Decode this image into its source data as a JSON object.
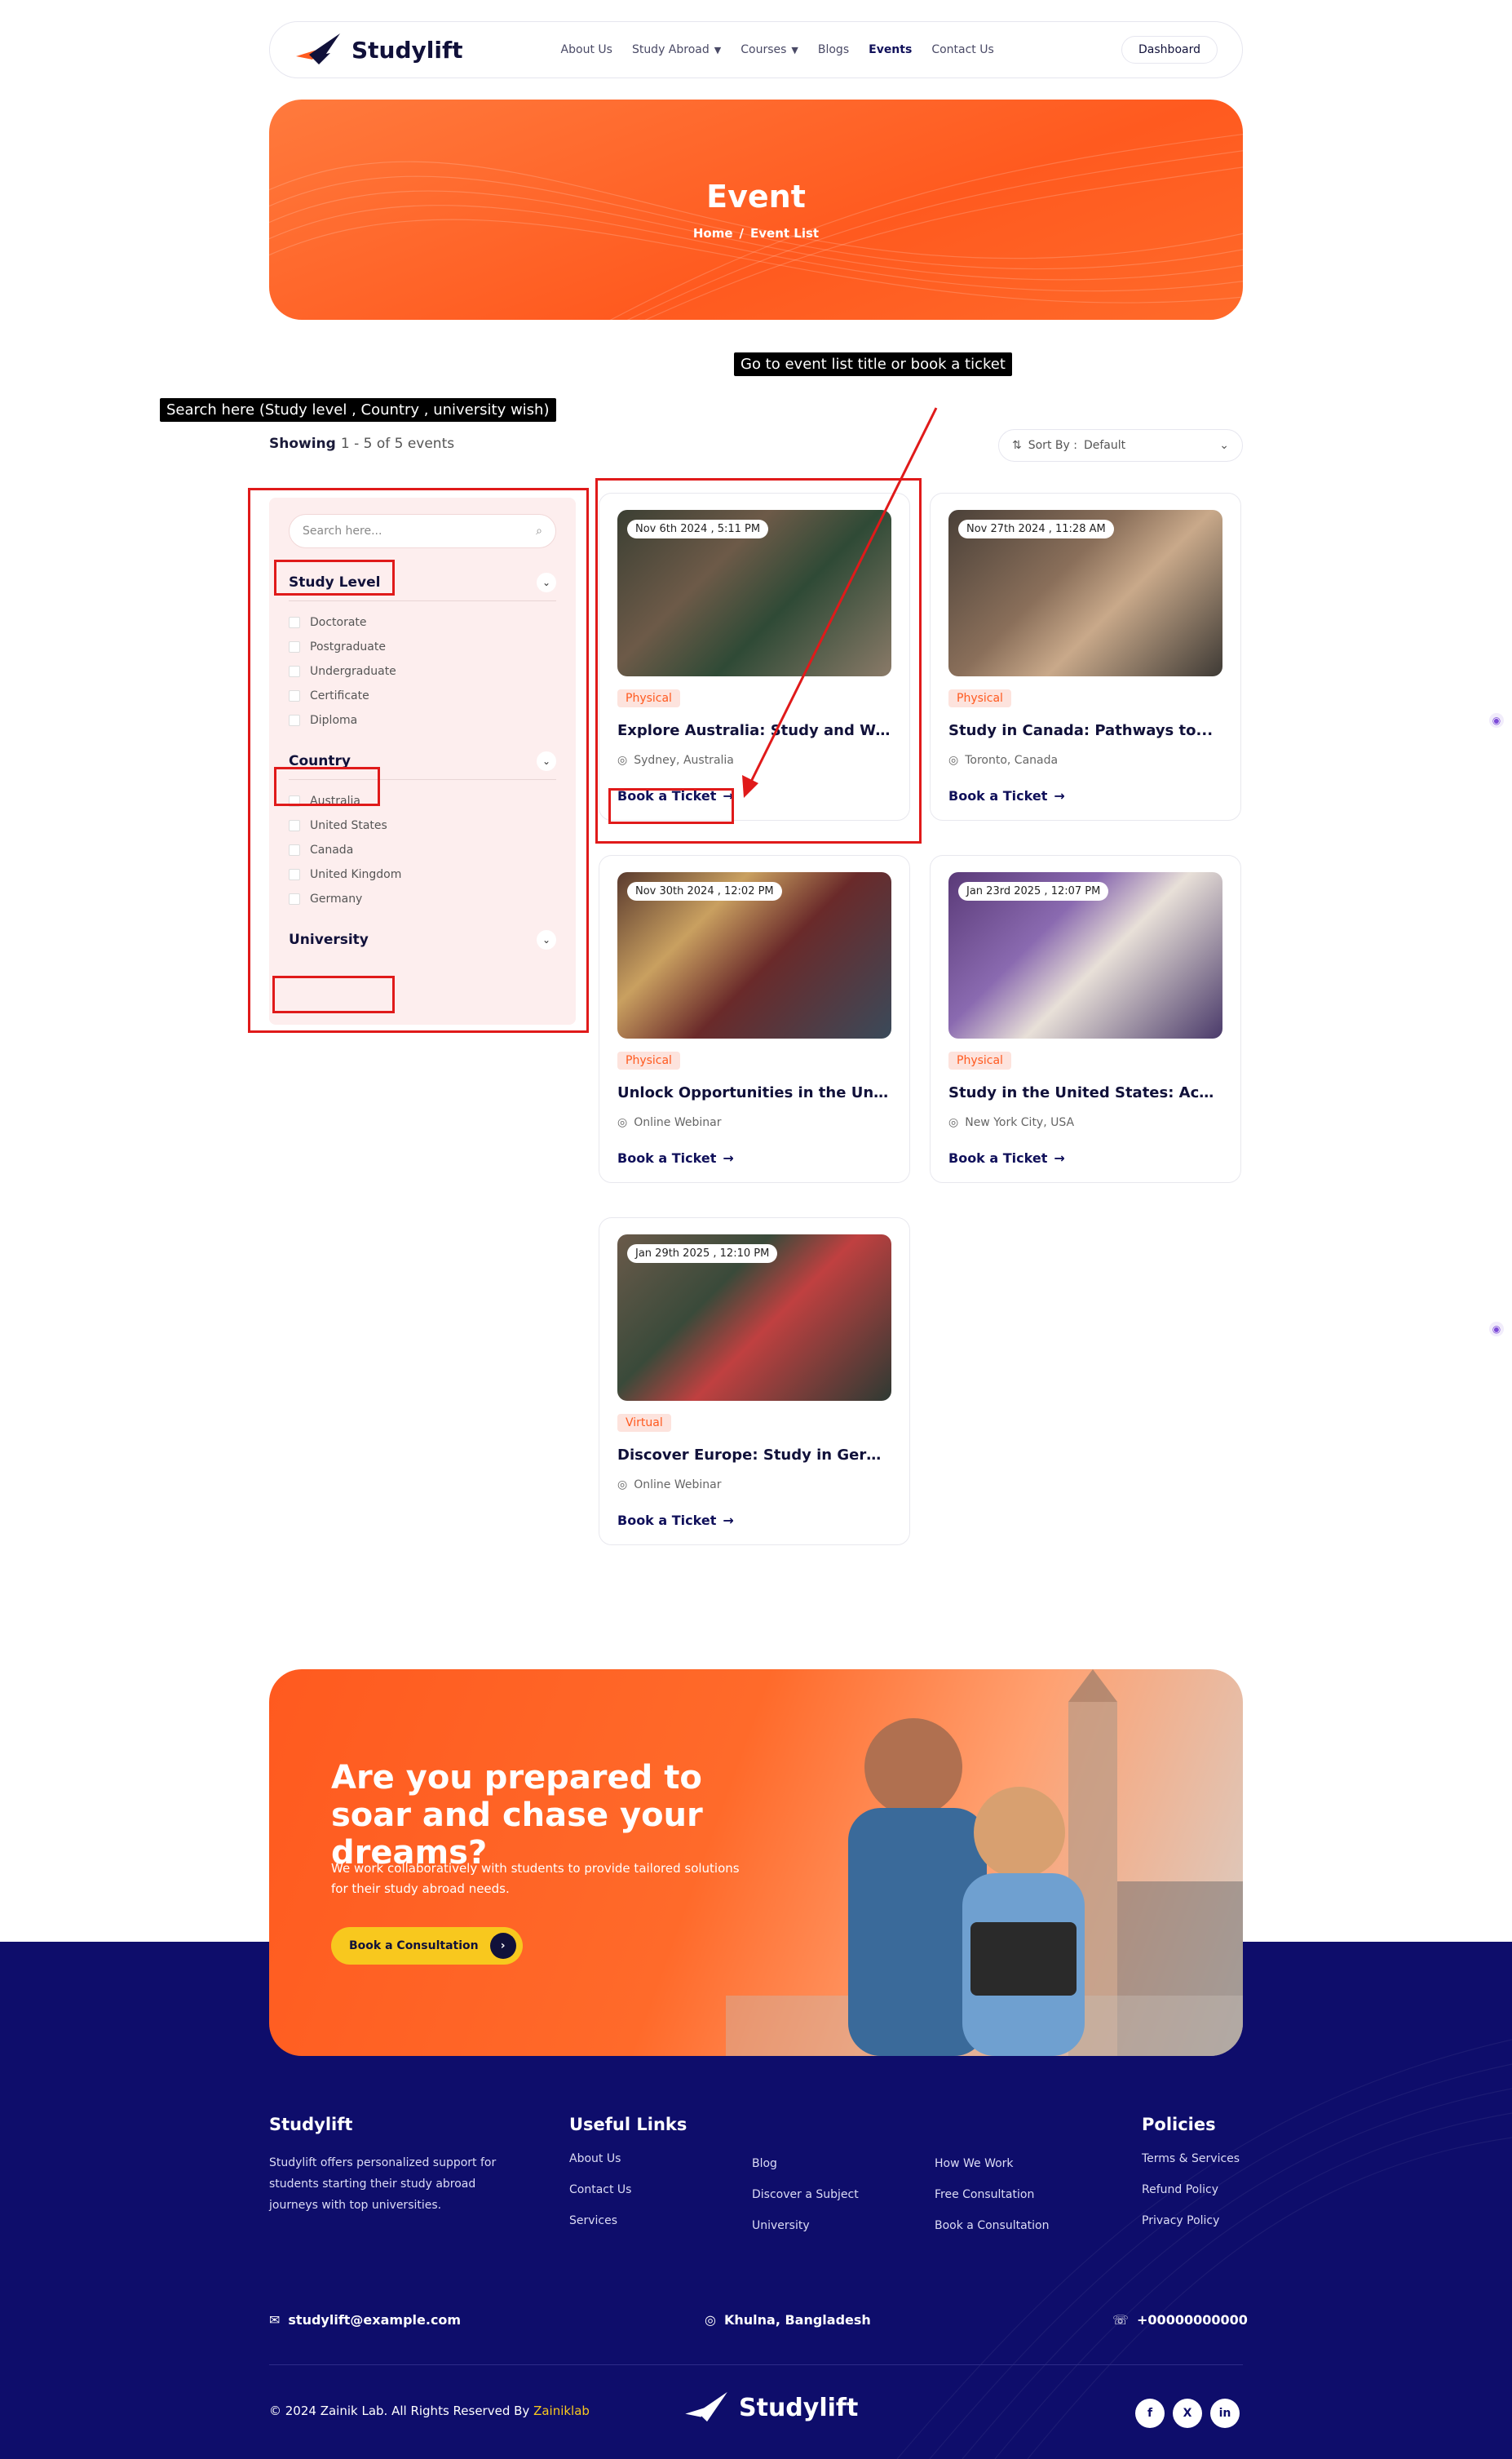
{
  "brand": {
    "name": "Studylift"
  },
  "nav": {
    "items": [
      {
        "label": "About Us"
      },
      {
        "label": "Study Abroad",
        "dropdown": true
      },
      {
        "label": "Courses",
        "dropdown": true
      },
      {
        "label": "Blogs"
      },
      {
        "label": "Events",
        "active": true
      },
      {
        "label": "Contact Us"
      }
    ],
    "dashboard_label": "Dashboard"
  },
  "hero": {
    "title": "Event",
    "breadcrumb_home": "Home",
    "breadcrumb_sep": "/",
    "breadcrumb_current": "Event List"
  },
  "annotations": {
    "tip_event": "Go to event list title or book a ticket",
    "tip_search": "Search here (Study level , Country , university wish)"
  },
  "results": {
    "label": "Showing",
    "count": "1 - 5 of 5 events"
  },
  "sort": {
    "label": "Sort By :",
    "value": "Default"
  },
  "sidebar": {
    "search_placeholder": "Search here...",
    "filters": [
      {
        "title": "Study Level",
        "options": [
          "Doctorate",
          "Postgraduate",
          "Undergraduate",
          "Certificate",
          "Diploma"
        ]
      },
      {
        "title": "Country",
        "options": [
          "Australia",
          "United States",
          "Canada",
          "United Kingdom",
          "Germany"
        ]
      },
      {
        "title": "University",
        "options": []
      }
    ]
  },
  "events": [
    {
      "date": "Nov 6th 2024 , 5:11 PM",
      "type": "Physical",
      "title": "Explore Australia: Study and Work...",
      "location": "Sydney, Australia",
      "cta": "Book a Ticket"
    },
    {
      "date": "Nov 27th 2024 , 11:28 AM",
      "type": "Physical",
      "title": "Study in Canada: Pathways to...",
      "location": "Toronto, Canada",
      "cta": "Book a Ticket"
    },
    {
      "date": "Nov 30th 2024 , 12:02 PM",
      "type": "Physical",
      "title": "Unlock Opportunities in the United...",
      "location": "Online Webinar",
      "cta": "Book a Ticket"
    },
    {
      "date": "Jan 23rd 2025 , 12:07 PM",
      "type": "Physical",
      "title": "Study in the United States: Achieve...",
      "location": "New York City, USA",
      "cta": "Book a Ticket"
    },
    {
      "date": "Jan 29th 2025 , 12:10 PM",
      "type": "Virtual",
      "title": "Discover Europe: Study in Germany...",
      "location": "Online Webinar",
      "cta": "Book a Ticket"
    }
  ],
  "cta": {
    "title": "Are you prepared to soar and chase your dreams?",
    "text": "We work collaboratively with students to provide tailored solutions for their study abroad needs.",
    "button": "Book a Consultation"
  },
  "footer": {
    "about_title": "Studylift",
    "about_text": "Studylift offers personalized support for students starting their study abroad journeys with top universities.",
    "useful_title": "Useful Links",
    "useful_col1": [
      "About Us",
      "Contact Us",
      "Services"
    ],
    "useful_col2": [
      "Blog",
      "Discover a Subject",
      "University"
    ],
    "useful_col3": [
      "How We Work",
      "Free Consultation",
      "Book a Consultation"
    ],
    "policies_title": "Policies",
    "policies": [
      "Terms & Services",
      "Refund Policy",
      "Privacy Policy"
    ],
    "email": "studylift@example.com",
    "address": "Khulna, Bangladesh",
    "phone": "+00000000000",
    "copyright_prefix": "© 2024 Zainik Lab. All Rights Reserved By",
    "copyright_brand": "Zainiklab",
    "socials": [
      "facebook-icon",
      "x-icon",
      "linkedin-icon"
    ]
  },
  "colors": {
    "accent": "#ff5a1f",
    "navy": "#0e0d6b",
    "yellow": "#f8c81e",
    "annotation": "#e01a1a"
  }
}
